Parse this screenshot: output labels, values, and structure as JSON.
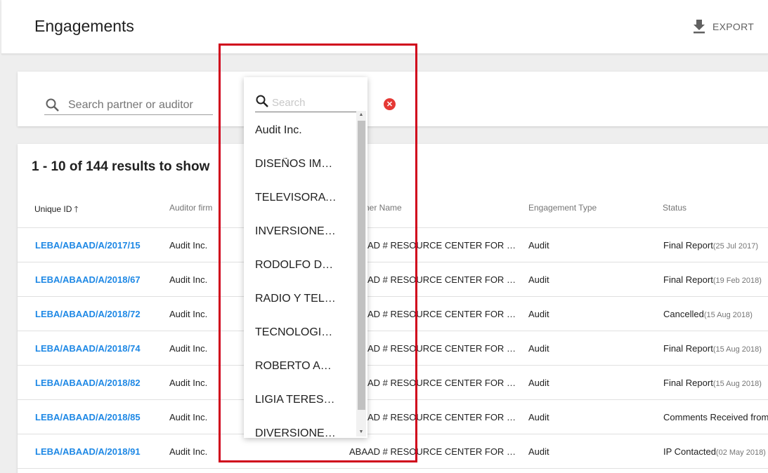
{
  "header": {
    "title": "Engagements",
    "export_label": "EXPORT"
  },
  "filters": {
    "search_placeholder": "Search partner or auditor"
  },
  "dropdown": {
    "search_placeholder": "Search",
    "items": [
      "Audit Inc.",
      "DISEÑOS IMPR…",
      "TELEVISORA NI…",
      "INVERSIONES …",
      "RODOLFO DE JE…",
      "RADIO Y TELEVI…",
      "TECNOLOGIA IN…",
      "ROBERTO ANTO…",
      "LIGIA TERESA Y…",
      "DIVERSIONES U…"
    ]
  },
  "table": {
    "results_text": "1 - 10 of 144 results to show",
    "columns": {
      "unique_id": "Unique ID",
      "auditor_firm": "Auditor firm",
      "partner_name": "Partner Name",
      "engagement_type": "Engagement Type",
      "status": "Status"
    },
    "rows": [
      {
        "id": "LEBA/ABAAD/A/2017/15",
        "firm": "Audit Inc.",
        "partner": "ABAAD # RESOURCE CENTER FOR GEN…",
        "type": "Audit",
        "status": "Final Report",
        "date": "(25 Jul 2017)"
      },
      {
        "id": "LEBA/ABAAD/A/2018/67",
        "firm": "Audit Inc.",
        "partner": "ABAAD # RESOURCE CENTER FOR GEN…",
        "type": "Audit",
        "status": "Final Report",
        "date": "(19 Feb 2018)"
      },
      {
        "id": "LEBA/ABAAD/A/2018/72",
        "firm": "Audit Inc.",
        "partner": "ABAAD # RESOURCE CENTER FOR GEN…",
        "type": "Audit",
        "status": "Cancelled",
        "date": "(15 Aug 2018)"
      },
      {
        "id": "LEBA/ABAAD/A/2018/74",
        "firm": "Audit Inc.",
        "partner": "ABAAD # RESOURCE CENTER FOR GEN…",
        "type": "Audit",
        "status": "Final Report",
        "date": "(15 Aug 2018)"
      },
      {
        "id": "LEBA/ABAAD/A/2018/82",
        "firm": "Audit Inc.",
        "partner": "ABAAD # RESOURCE CENTER FOR GEN…",
        "type": "Audit",
        "status": "Final Report",
        "date": "(15 Aug 2018)"
      },
      {
        "id": "LEBA/ABAAD/A/2018/85",
        "firm": "Audit Inc.",
        "partner": "ABAAD # RESOURCE CENTER FOR GEN…",
        "type": "Audit",
        "status": "Comments Received from",
        "date": ""
      },
      {
        "id": "LEBA/ABAAD/A/2018/91",
        "firm": "Audit Inc.",
        "partner": "ABAAD # RESOURCE CENTER FOR GEN…",
        "type": "Audit",
        "status": "IP Contacted",
        "date": "(02 May 2018)"
      }
    ]
  },
  "colors": {
    "link": "#1e88e5",
    "highlight": "#d0021b",
    "clear": "#e53935"
  }
}
